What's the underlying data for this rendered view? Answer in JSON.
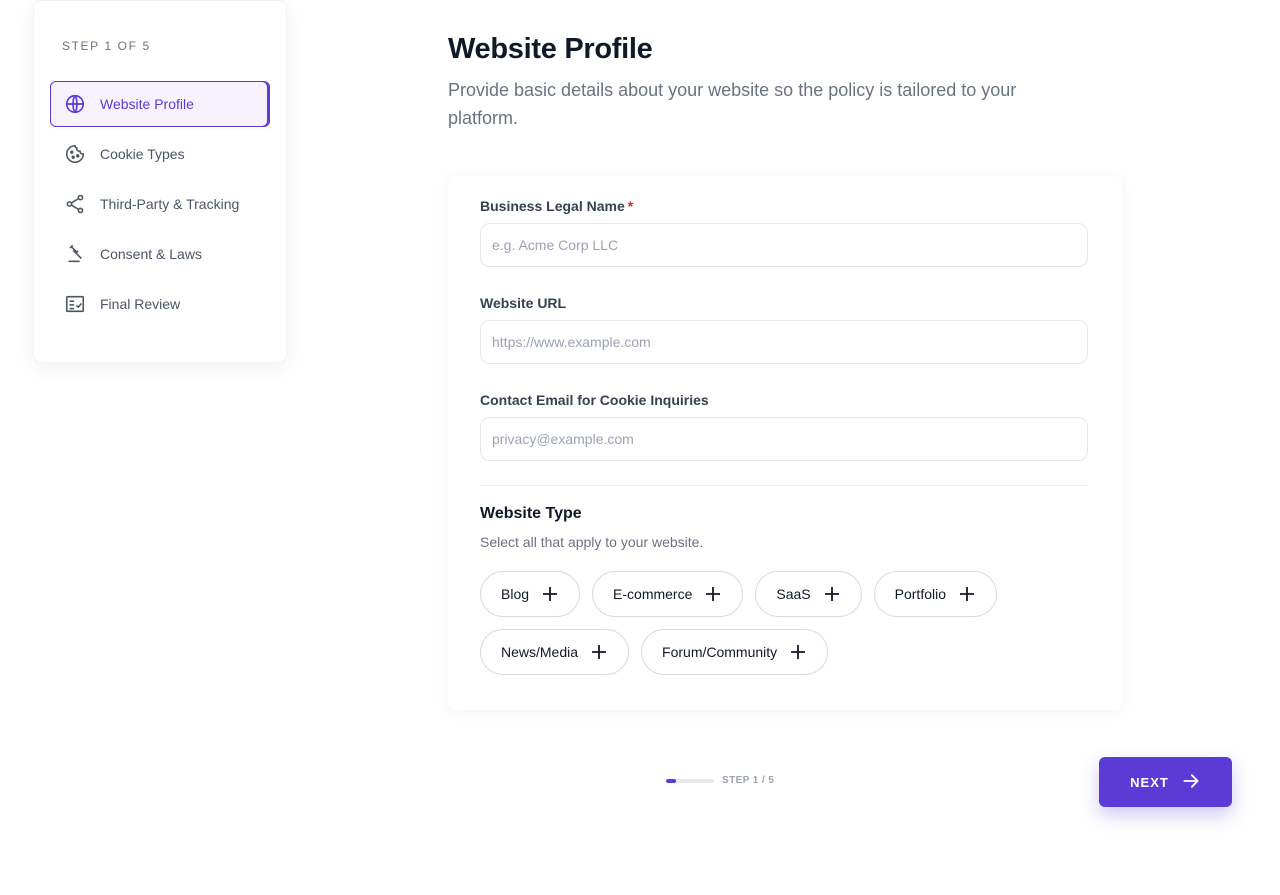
{
  "sidebar": {
    "step_label": "STEP 1 OF 5",
    "items": [
      {
        "label": "Website Profile",
        "icon": "globe-icon",
        "active": true
      },
      {
        "label": "Cookie Types",
        "icon": "cookie-icon",
        "active": false
      },
      {
        "label": "Third-Party & Tracking",
        "icon": "share-icon",
        "active": false
      },
      {
        "label": "Consent & Laws",
        "icon": "gavel-icon",
        "active": false
      },
      {
        "label": "Final Review",
        "icon": "checklist-icon",
        "active": false
      }
    ]
  },
  "header": {
    "title": "Website Profile",
    "subtitle": "Provide basic details about your website so the policy is tailored to your platform."
  },
  "form": {
    "business_name": {
      "label": "Business Legal Name",
      "required_mark": "*",
      "placeholder": "e.g. Acme Corp LLC",
      "value": ""
    },
    "website_url": {
      "label": "Website URL",
      "placeholder": "https://www.example.com",
      "value": ""
    },
    "contact_email": {
      "label": "Contact Email for Cookie Inquiries",
      "placeholder": "privacy@example.com",
      "value": ""
    },
    "website_type": {
      "title": "Website Type",
      "subtitle": "Select all that apply to your website.",
      "options": [
        "Blog",
        "E-commerce",
        "SaaS",
        "Portfolio",
        "News/Media",
        "Forum/Community"
      ]
    }
  },
  "footer": {
    "progress_text": "STEP 1 / 5",
    "progress_fraction": 0.2,
    "next_label": "NEXT"
  },
  "colors": {
    "accent": "#5b3bd6",
    "required": "#dc2626"
  }
}
